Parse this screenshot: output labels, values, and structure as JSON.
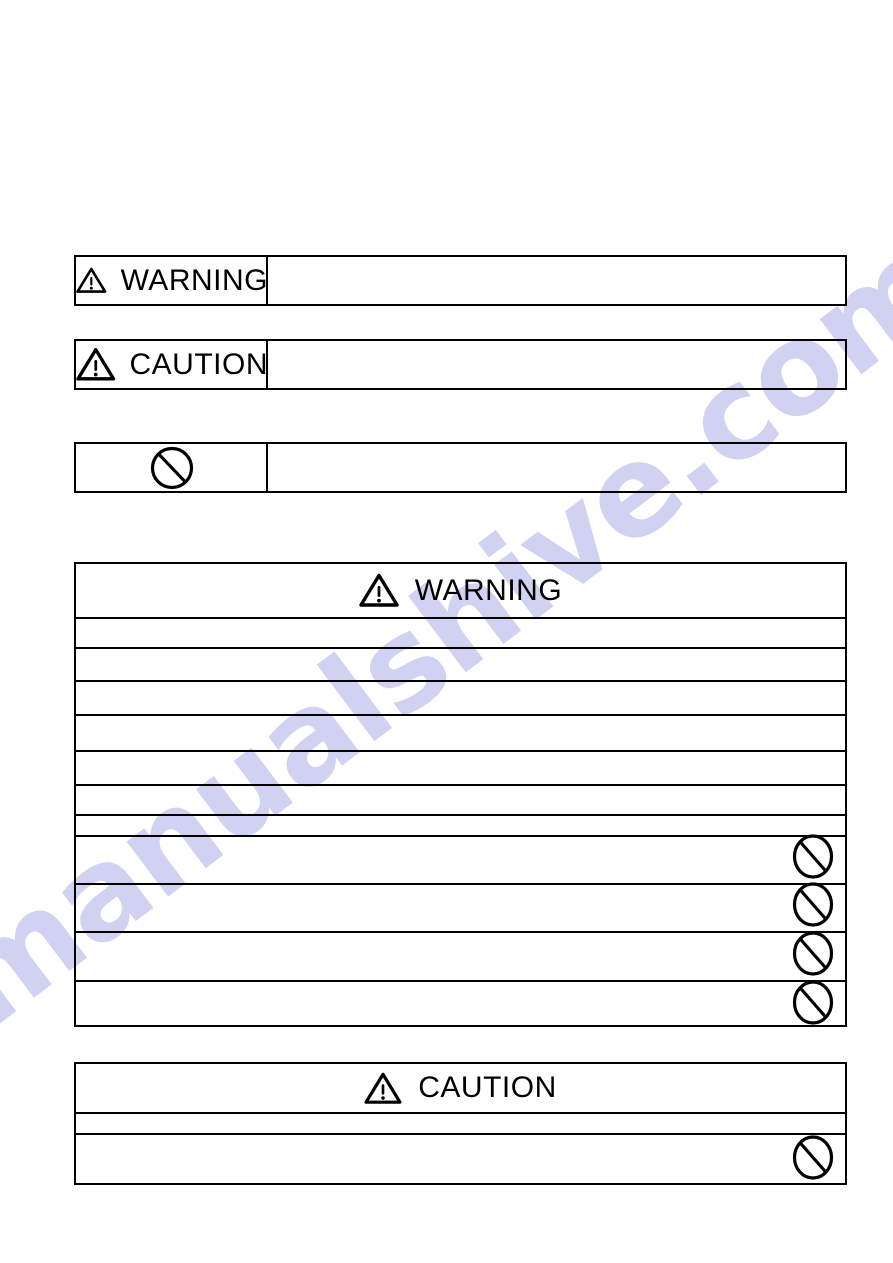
{
  "document": {
    "page_background": "#ffffff",
    "ink_color": "#000000"
  },
  "watermark": {
    "text": "manualshive.com",
    "color": "#c9c9ef"
  },
  "legend": {
    "rows": [
      {
        "icon": "warning-triangle-icon",
        "signal_word": "WARNING",
        "description": ""
      },
      {
        "icon": "warning-triangle-icon",
        "signal_word": "CAUTION",
        "description": ""
      },
      {
        "icon": "prohibition-icon",
        "signal_word": "",
        "description": ""
      }
    ]
  },
  "warning_table": {
    "header": {
      "icon": "warning-triangle-icon",
      "title": "WARNING"
    },
    "rows": [
      {
        "text": "",
        "icon": ""
      },
      {
        "text": "",
        "icon": ""
      },
      {
        "text": "",
        "icon": ""
      },
      {
        "text": "",
        "icon": ""
      },
      {
        "text": "",
        "icon": ""
      },
      {
        "text": "",
        "icon": ""
      },
      {
        "text": "",
        "icon": ""
      },
      {
        "text": "",
        "icon": "prohibition-icon"
      },
      {
        "text": "",
        "icon": "prohibition-icon"
      },
      {
        "text": "",
        "icon": "prohibition-icon"
      },
      {
        "text": "",
        "icon": "prohibition-icon"
      }
    ]
  },
  "caution_table": {
    "header": {
      "icon": "warning-triangle-icon",
      "title": "CAUTION"
    },
    "rows": [
      {
        "text": "",
        "icon": ""
      },
      {
        "text": "",
        "icon": "prohibition-icon"
      }
    ]
  }
}
